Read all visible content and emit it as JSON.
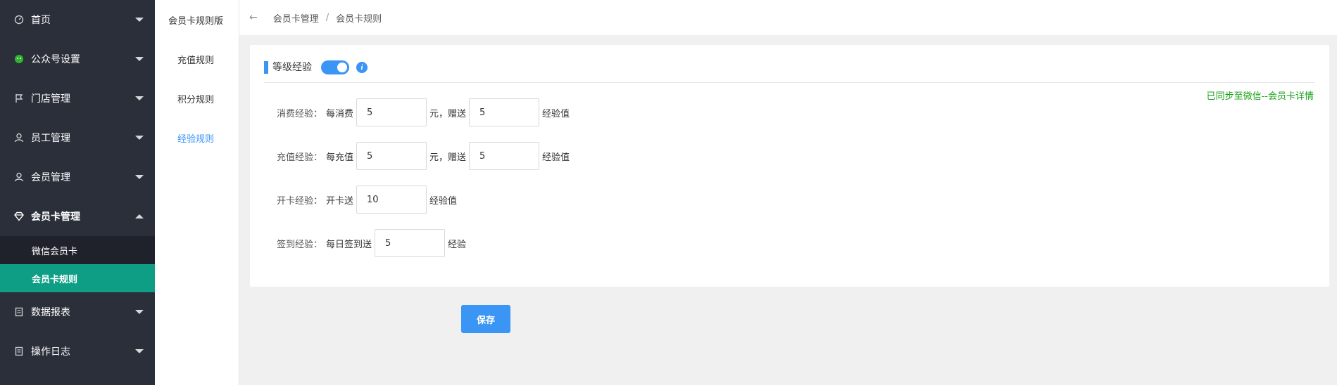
{
  "sidebar": {
    "items": [
      {
        "label": "首页",
        "icon": "dashboard-icon"
      },
      {
        "label": "公众号设置",
        "icon": "wechat-icon"
      },
      {
        "label": "门店管理",
        "icon": "flag-icon"
      },
      {
        "label": "员工管理",
        "icon": "staff-icon"
      },
      {
        "label": "会员管理",
        "icon": "member-icon"
      },
      {
        "label": "会员卡管理",
        "icon": "diamond-icon"
      },
      {
        "label": "数据报表",
        "icon": "report-icon"
      },
      {
        "label": "操作日志",
        "icon": "log-icon"
      }
    ],
    "sub_items": [
      {
        "label": "微信会员卡"
      },
      {
        "label": "会员卡规则"
      }
    ]
  },
  "sidebar2": {
    "title": "会员卡规则版",
    "items": [
      {
        "label": "充值规则"
      },
      {
        "label": "积分规则"
      },
      {
        "label": "经验规则"
      }
    ]
  },
  "breadcrumb": {
    "back": "←",
    "first": "会员卡管理",
    "sep": "/",
    "current": "会员卡规则"
  },
  "card": {
    "title": "等级经验",
    "toggle_on": true,
    "info": "i",
    "sync": "已同步至微信--会员卡详情",
    "rows": {
      "consume": {
        "label": "消费经验：",
        "prefix": "每消费",
        "amount": "5",
        "mid": "元，赠送",
        "exp": "5",
        "suffix": "经验值"
      },
      "recharge": {
        "label": "充值经验：",
        "prefix": "每充值",
        "amount": "5",
        "mid": "元，赠送",
        "exp": "5",
        "suffix": "经验值"
      },
      "opencard": {
        "label": "开卡经验：",
        "prefix": "开卡送",
        "exp": "10",
        "suffix": "经验值"
      },
      "checkin": {
        "label": "签到经验：",
        "prefix": "每日签到送",
        "exp": "5",
        "suffix": "经验"
      }
    }
  },
  "save_label": "保存",
  "colors": {
    "sidebar": "#2b2f3a",
    "active": "#0e9e86",
    "accent": "#3a95f5",
    "sync": "#1aa11a"
  }
}
